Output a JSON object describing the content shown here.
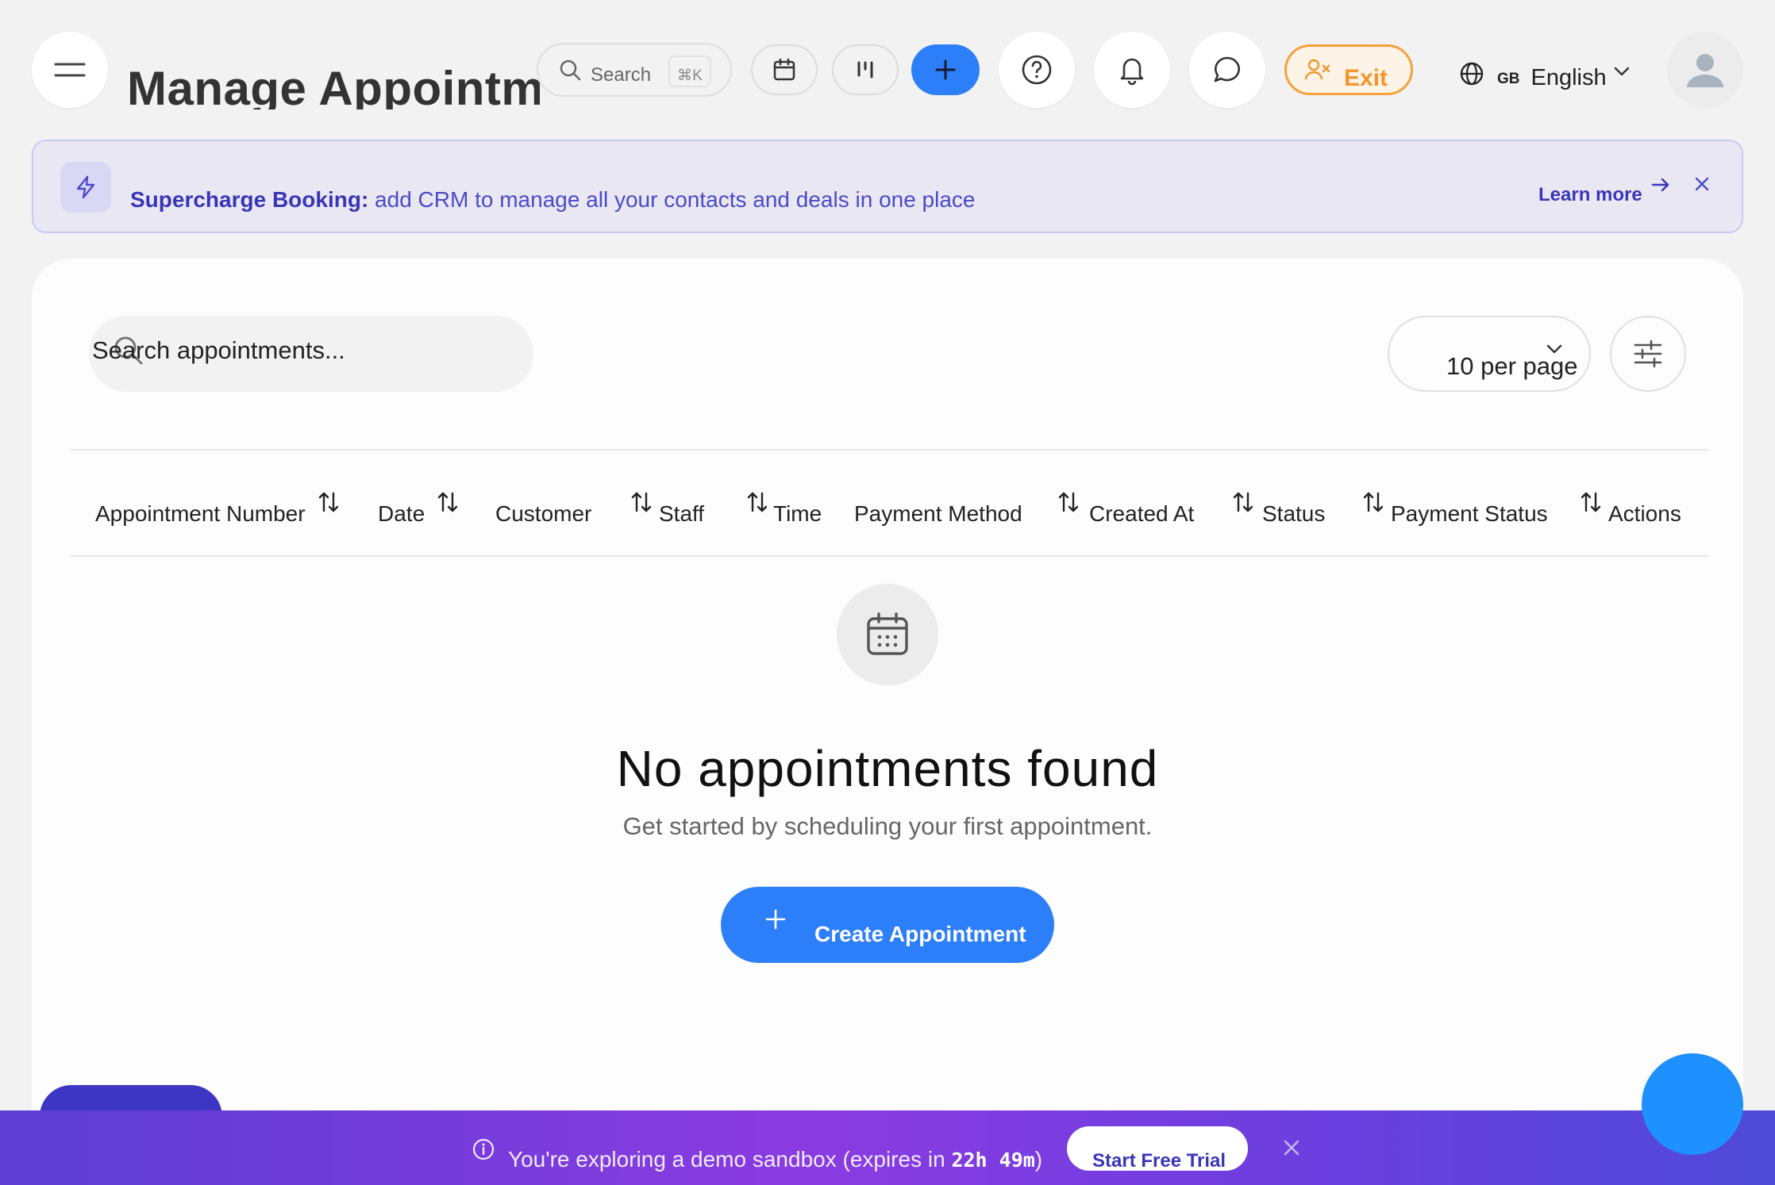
{
  "header": {
    "title": "Manage Appointments",
    "search_label": "Search",
    "search_shortcut": "⌘K",
    "exit_label": "Exit",
    "language_code": "GB",
    "language_name": "English"
  },
  "banner": {
    "highlight": "Supercharge Booking:",
    "message": "add CRM to manage all your contacts and deals in one place",
    "learn_more": "Learn more"
  },
  "table": {
    "search_placeholder": "Search appointments...",
    "per_page": "10 per page",
    "columns": [
      {
        "label": "Appointment Number",
        "sortable": true
      },
      {
        "label": "Date",
        "sortable": true
      },
      {
        "label": "Customer",
        "sortable": true
      },
      {
        "label": "Staff",
        "sortable": true
      },
      {
        "label": "Time",
        "sortable": false
      },
      {
        "label": "Payment Method",
        "sortable": true
      },
      {
        "label": "Created At",
        "sortable": true
      },
      {
        "label": "Status",
        "sortable": true
      },
      {
        "label": "Payment Status",
        "sortable": true
      },
      {
        "label": "Actions",
        "sortable": false
      }
    ]
  },
  "empty_state": {
    "title": "No appointments found",
    "subtitle": "Get started by scheduling your first appointment.",
    "button_label": "Create Appointment"
  },
  "demo_bar": {
    "message": "You're exploring a demo sandbox (expires in ",
    "expires": "22h 49m",
    "suffix": ")",
    "button_label": "Start Free Trial"
  },
  "colors": {
    "accent": "#2d7ff9",
    "banner_text": "#3a35b8",
    "exit": "#f5962c",
    "demo_bar_start": "#5b3ed3",
    "demo_bar_mid": "#8a3be0"
  },
  "icons": [
    "menu-icon",
    "search-icon",
    "calendar-icon",
    "kanban-icon",
    "plus-icon",
    "help-icon",
    "bell-icon",
    "chat-icon",
    "user-x-icon",
    "globe-icon",
    "chevron-down-icon",
    "user-icon",
    "lightning-icon",
    "arrow-right-icon",
    "close-icon",
    "filter-icon",
    "sort-icon",
    "info-icon"
  ]
}
